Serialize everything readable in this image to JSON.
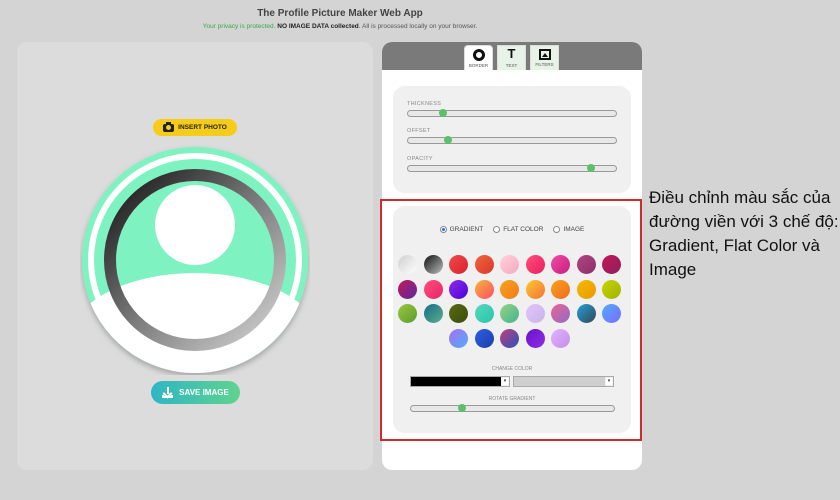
{
  "header": {
    "title": "The Profile Picture Maker Web App",
    "privacy_green": "Your privacy is protected.",
    "privacy_bold": "NO IMAGE DATA collected",
    "privacy_rest": ". All is processed locally on your browser."
  },
  "preview": {
    "insert_label": "INSERT PHOTO",
    "save_label": "SAVE IMAGE"
  },
  "tabs": [
    {
      "label": "BORDER",
      "icon": "circle-icon"
    },
    {
      "label": "TEXT",
      "icon": "text-icon"
    },
    {
      "label": "FILTERS",
      "icon": "image-icon"
    }
  ],
  "sliders": [
    {
      "label": "THICKNESS",
      "value": 0.17
    },
    {
      "label": "OFFSET",
      "value": 0.19
    },
    {
      "label": "OPACITY",
      "value": 0.88
    }
  ],
  "mode": {
    "options": [
      "GRADIENT",
      "FLAT COLOR",
      "IMAGE"
    ],
    "selected": "GRADIENT"
  },
  "swatches": [
    [
      "#cfcfcf",
      "#ffffff"
    ],
    [
      "#111111",
      "#bdbdbd"
    ],
    [
      "#f04a4a",
      "#d9222e"
    ],
    [
      "#f2633f",
      "#d63a2a"
    ],
    [
      "#ffd1dc",
      "#f6a9c0"
    ],
    [
      "#ff4d7d",
      "#ea1f5d"
    ],
    [
      "#f24aa8",
      "#c91f7e"
    ],
    [
      "#b3457f",
      "#8a2f6a"
    ],
    [
      "#c2185b",
      "#8e1f5a"
    ],
    [
      "#c2185b",
      "#5c2aa0"
    ],
    [
      "#ff4f7a",
      "#e8236b"
    ],
    [
      "#8e2de2",
      "#4a00e0"
    ],
    [
      "#f7b733",
      "#fc4a6a"
    ],
    [
      "#f7a21c",
      "#f37b1d"
    ],
    [
      "#fdc830",
      "#f37335"
    ],
    [
      "#f9a21b",
      "#f16b1c"
    ],
    [
      "#f5b800",
      "#e89a00"
    ],
    [
      "#c8d400",
      "#9fb300"
    ],
    [
      "#9bc53d",
      "#5a9e2e"
    ],
    [
      "#1a6b8a",
      "#56b08b"
    ],
    [
      "#5a6b10",
      "#3a4a10"
    ],
    [
      "#56d8c0",
      "#26c6a6"
    ],
    [
      "#9ad28a",
      "#3fb58a"
    ],
    [
      "#e0c3fc",
      "#c9b5e8"
    ],
    [
      "#f06292",
      "#8e6cc9"
    ],
    [
      "#26a0da",
      "#314755"
    ],
    [
      "#4facfe",
      "#7b6cf6"
    ],
    [
      "#a770ef",
      "#4facfe"
    ],
    [
      "#2b5ee6",
      "#1d3fa6"
    ],
    [
      "#c0407a",
      "#2a52be"
    ],
    [
      "#6a11cb",
      "#8e2de2"
    ],
    [
      "#e0b3ff",
      "#c58de8"
    ]
  ],
  "colors": {
    "change_color_label": "CHANGE COLOR",
    "color1": "#000000",
    "color2": "#cfcfcf",
    "rotate_label": "ROTATE GRADIENT",
    "rotate_value": 0.25
  },
  "annotation": "Điều chỉnh màu sắc của đường viền với 3 chế độ: Gradient, Flat Color và Image",
  "accent": "#cf2d2d"
}
